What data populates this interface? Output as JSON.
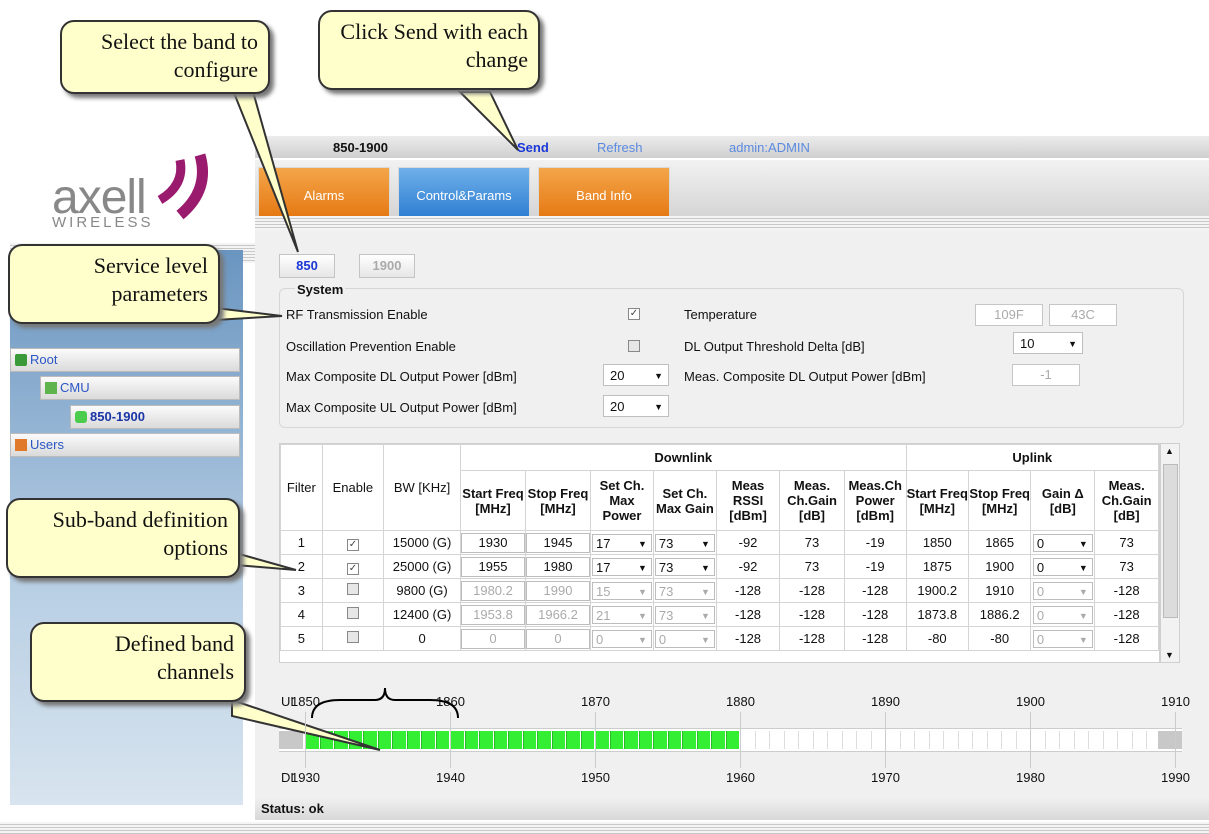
{
  "callouts": {
    "select_band": "Select the band to configure",
    "click_send": "Click Send with each change",
    "service_level": "Service level parameters",
    "subband": "Sub-band definition options",
    "defined_channels": "Defined band channels"
  },
  "topbar": {
    "device": "850-1900",
    "send": "Send",
    "refresh": "Refresh",
    "user": "admin:ADMIN"
  },
  "logo": {
    "brand": "axell",
    "sub": "WIRELESS"
  },
  "tree": {
    "root": "Root",
    "cmu": "CMU",
    "device": "850-1900",
    "users": "Users"
  },
  "tabs": [
    "Alarms",
    "Control&Params",
    "Band Info"
  ],
  "bands": [
    "850",
    "1900"
  ],
  "system": {
    "title": "System",
    "rf_tx_enable": "RF Transmission Enable",
    "osc_prev_enable": "Oscillation Prevention Enable",
    "max_dl_power": "Max Composite DL Output Power [dBm]",
    "max_dl_power_value": "20",
    "max_ul_power": "Max Composite UL Output Power [dBm]",
    "max_ul_power_value": "20",
    "temperature": "Temperature",
    "temp_f": "109F",
    "temp_c": "43C",
    "dl_threshold": "DL Output Threshold Delta [dB]",
    "dl_threshold_value": "10",
    "meas_dl_power": "Meas. Composite DL Output Power [dBm]",
    "meas_dl_power_value": "-1"
  },
  "table": {
    "group_downlink": "Downlink",
    "group_uplink": "Uplink",
    "headers": [
      "Filter",
      "Enable",
      "BW [KHz]",
      "Start Freq [MHz]",
      "Stop Freq [MHz]",
      "Set Ch. Max Power",
      "Set Ch. Max Gain",
      "Meas RSSI [dBm]",
      "Meas. Ch.Gain [dB]",
      "Meas.Ch Power [dBm]",
      "Start Freq [MHz]",
      "Stop Freq [MHz]",
      "Gain Δ [dB]",
      "Meas. Ch.Gain [dB]"
    ],
    "rows": [
      {
        "filter": "1",
        "enabled": true,
        "bw": "15000 (G)",
        "dl_start": "1930",
        "dl_stop": "1945",
        "max_power": "17",
        "max_gain": "73",
        "rssi": "-92",
        "ch_gain": "73",
        "ch_power": "-19",
        "ul_start": "1850",
        "ul_stop": "1865",
        "gain_delta": "0",
        "ul_gain": "73"
      },
      {
        "filter": "2",
        "enabled": true,
        "bw": "25000 (G)",
        "dl_start": "1955",
        "dl_stop": "1980",
        "max_power": "17",
        "max_gain": "73",
        "rssi": "-92",
        "ch_gain": "73",
        "ch_power": "-19",
        "ul_start": "1875",
        "ul_stop": "1900",
        "gain_delta": "0",
        "ul_gain": "73"
      },
      {
        "filter": "3",
        "enabled": false,
        "bw": "9800 (G)",
        "dl_start": "1980.2",
        "dl_stop": "1990",
        "max_power": "15",
        "max_gain": "73",
        "rssi": "-128",
        "ch_gain": "-128",
        "ch_power": "-128",
        "ul_start": "1900.2",
        "ul_stop": "1910",
        "gain_delta": "0",
        "ul_gain": "-128"
      },
      {
        "filter": "4",
        "enabled": false,
        "bw": "12400 (G)",
        "dl_start": "1953.8",
        "dl_stop": "1966.2",
        "max_power": "21",
        "max_gain": "73",
        "rssi": "-128",
        "ch_gain": "-128",
        "ch_power": "-128",
        "ul_start": "1873.8",
        "ul_stop": "1886.2",
        "gain_delta": "0",
        "ul_gain": "-128"
      },
      {
        "filter": "5",
        "enabled": false,
        "bw": "0",
        "dl_start": "0",
        "dl_stop": "0",
        "max_power": "0",
        "max_gain": "0",
        "rssi": "-128",
        "ch_gain": "-128",
        "ch_power": "-128",
        "ul_start": "-80",
        "ul_stop": "-80",
        "gain_delta": "0",
        "ul_gain": "-128"
      }
    ]
  },
  "channels": {
    "ul_label": "UL",
    "dl_label": "DL",
    "ul_ticks": [
      "1850",
      "1860",
      "1870",
      "1880",
      "1890",
      "1900",
      "1910"
    ],
    "dl_ticks": [
      "1930",
      "1940",
      "1950",
      "1960",
      "1970",
      "1980",
      "1990"
    ],
    "active_ranges": [
      [
        1850,
        1861
      ],
      [
        1855,
        1880
      ]
    ],
    "active_color": "#33ee33"
  },
  "status": "Status: ok"
}
